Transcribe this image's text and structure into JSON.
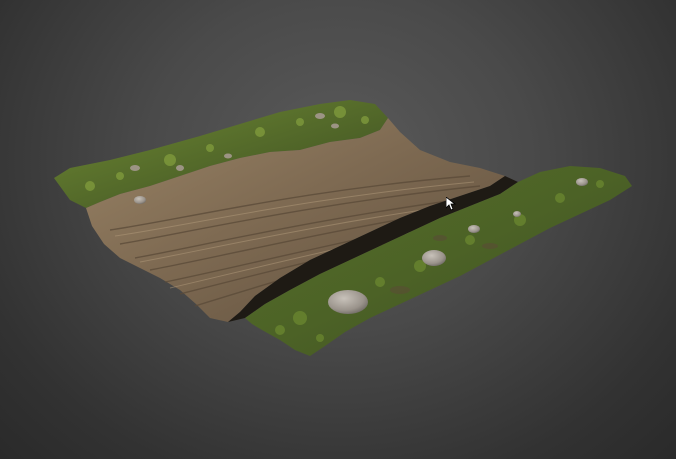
{
  "viewer": {
    "background_colors": [
      "#5a5a5a",
      "#2a2a2a"
    ]
  },
  "scan_model": {
    "icon": "terrain-scan-3d-model",
    "materials": {
      "grass": "#5f7a2e",
      "soil": "#8a7458",
      "rock": "#a9a29a",
      "shadow": "#1e1a14"
    }
  },
  "cursor": {
    "icon": "mouse-pointer-icon"
  }
}
